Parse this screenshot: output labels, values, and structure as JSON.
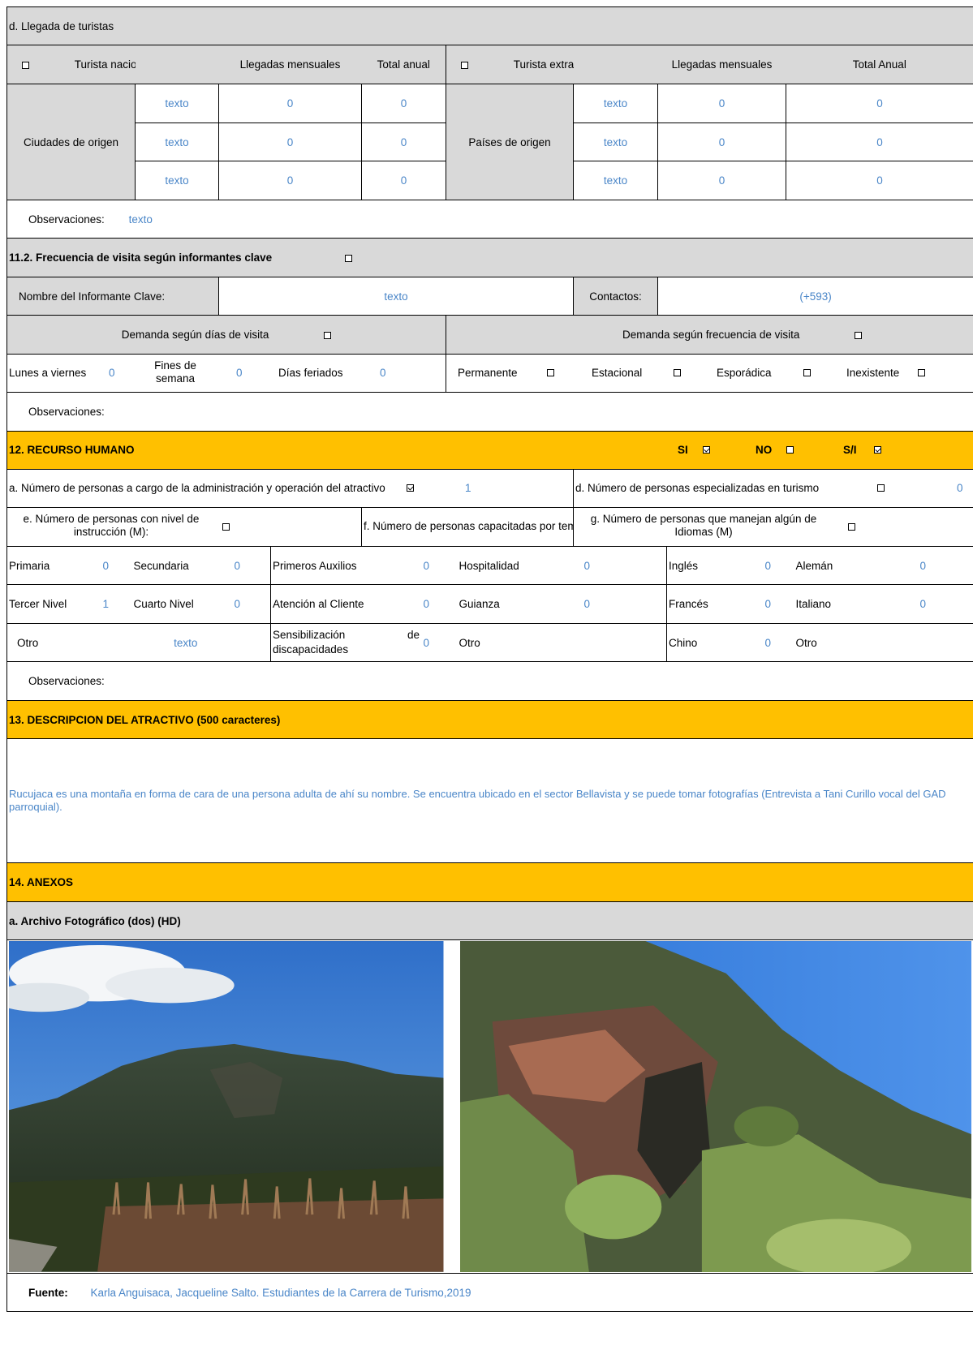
{
  "llegada": {
    "title": "d. Llegada de turistas",
    "nacional_label": "Turista nacional",
    "llegadas_mensuales": "Llegadas mensuales",
    "total_anual": "Total anual",
    "extranjero_label": "Turista extranjero",
    "llegadas_mensuales_ext": "Llegadas mensuales",
    "total_anual_ext": "Total Anual",
    "ciudades_label": "Ciudades de origen",
    "paises_label": "Países de origen",
    "rows": [
      {
        "ciudad": "texto",
        "mensual": "0",
        "anual": "0",
        "pais": "texto",
        "mensual_ext": "0",
        "anual_ext": "0"
      },
      {
        "ciudad": "texto",
        "mensual": "0",
        "anual": "0",
        "pais": "texto",
        "mensual_ext": "0",
        "anual_ext": "0"
      },
      {
        "ciudad": "texto",
        "mensual": "0",
        "anual": "0",
        "pais": "texto",
        "mensual_ext": "0",
        "anual_ext": "0"
      }
    ],
    "observaciones_label": "Observaciones:",
    "observaciones_value": "texto"
  },
  "frecuencia": {
    "title": "11.2. Frecuencia de visita según informantes clave",
    "informante_label": "Nombre del Informante Clave:",
    "informante_value": "texto",
    "contactos_label": "Contactos:",
    "contactos_value": "(+593)",
    "demanda_dias_label": "Demanda según  días de visita",
    "demanda_frec_label": "Demanda según frecuencia de visita",
    "lunes_label": "Lunes a viernes",
    "lunes_value": "0",
    "fines_label": "Fines de semana",
    "fines_value": "0",
    "feriados_label": "Días feriados",
    "feriados_value": "0",
    "permanente": "Permanente",
    "estacional": "Estacional",
    "esporadica": "Esporádica",
    "inexistente": "Inexistente",
    "observaciones_label": "Observaciones:"
  },
  "recurso": {
    "title": "12. RECURSO HUMANO",
    "si": "SI",
    "no": "NO",
    "si_checked": true,
    "no_checked": false,
    "sn": "S/I",
    "sn_checked": true,
    "a_label": "a. Número de personas a cargo de la administración y operación del atractivo",
    "a_value": "1",
    "d_label": "d. Número de personas especializadas en turismo",
    "d_value": "0",
    "e_label": "e. Número de personas con nivel de instrucción (M):",
    "f_label": "f. Número de personas capacitadas por temática (M)",
    "g_label": "g. Número de personas que manejan algún de Idiomas (M)",
    "primaria": "Primaria",
    "primaria_v": "0",
    "secundaria": "Secundaria",
    "secundaria_v": "0",
    "primeros": "Primeros Auxilios",
    "primeros_v": "0",
    "hospitalidad": "Hospitalidad",
    "hospitalidad_v": "0",
    "ingles": "Inglés",
    "ingles_v": "0",
    "aleman": "Alemán",
    "aleman_v": "0",
    "tercer": "Tercer Nivel",
    "tercer_v": "1",
    "cuarto": "Cuarto Nivel",
    "cuarto_v": "0",
    "atencion": "Atención al Cliente",
    "atencion_v": "0",
    "guianza": "Guianza",
    "guianza_v": "0",
    "frances": "Francés",
    "frances_v": "0",
    "italiano": "Italiano",
    "italiano_v": "0",
    "otro1": "Otro",
    "otro1_v": "texto",
    "sensib_a": "Sensibilización",
    "sensib_de": "de",
    "sensib_b": "discapacidades",
    "sensib_v": "0",
    "otro2": "Otro",
    "chino": "Chino",
    "chino_v": "0",
    "otro3": "Otro",
    "observaciones_label": "Observaciones:"
  },
  "descripcion": {
    "title": "13. DESCRIPCION DEL ATRACTIVO (500 caracteres)",
    "text": "Rucujaca es una montaña en forma de cara de una persona adulta de ahí su nombre. Se encuentra ubicado en el sector Bellavista y se puede tomar fotografías (Entrevista a Tani Curillo vocal del GAD parroquial)."
  },
  "anexos": {
    "title": "14. ANEXOS",
    "archivo_label": "a. Archivo Fotográfico (dos) (HD)",
    "fuente_label": "Fuente:",
    "fuente_value": "Karla Anguisaca, Jacqueline Salto. Estudiantes de la Carrera de Turismo,2019"
  },
  "colors": {
    "header_gray": "#d9d9d9",
    "header_orange": "#ffc000",
    "value_blue": "#4a86c8"
  }
}
